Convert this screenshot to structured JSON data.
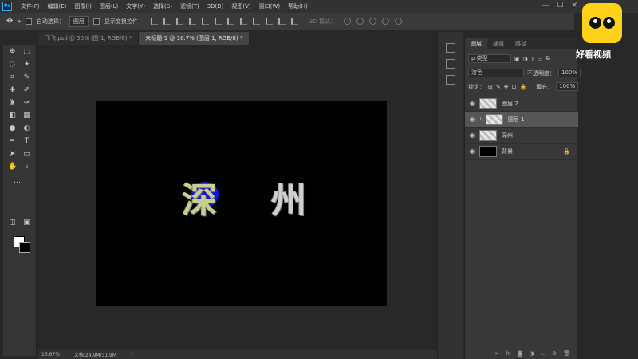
{
  "app": {
    "logo": "Ps"
  },
  "menu": [
    "文件(F)",
    "编辑(E)",
    "图像(I)",
    "图层(L)",
    "文字(Y)",
    "选择(S)",
    "滤镜(T)",
    "3D(D)",
    "视图(V)",
    "窗口(W)",
    "帮助(H)"
  ],
  "options": {
    "auto_select": "自动选择：",
    "target": "图层",
    "show_transform": "显示变换控件",
    "mode_3d": "3D 模式："
  },
  "tabs": [
    {
      "label": "飞飞.psd @ 50% (图 1, RGB/8) *",
      "active": false
    },
    {
      "label": "未标题-1 @ 16.7% (图层 1, RGB/8) *",
      "active": true
    }
  ],
  "canvas": {
    "char1": "深",
    "char2": "州"
  },
  "status": {
    "zoom": "16.67%",
    "doc": "文档:24.9M/31.9M"
  },
  "layers_panel": {
    "tabs": [
      "图层",
      "通道",
      "路径"
    ],
    "kind_filter": "ρ 类型",
    "blend_mode": "溶色",
    "opacity_label": "不透明度：",
    "opacity": "100%",
    "lock_label": "锁定：",
    "fill_label": "填充：",
    "fill": "100%",
    "layers": [
      {
        "name": "图层 2",
        "selected": false
      },
      {
        "name": "图层 1",
        "selected": true
      },
      {
        "name": "深州",
        "selected": false
      },
      {
        "name": "背景",
        "selected": false
      }
    ]
  },
  "watermark": {
    "text": "好看视频"
  },
  "colors": {
    "foreground": "#ffffff",
    "background": "#000000",
    "accent_blue": "#1414dc",
    "panel": "#383838"
  }
}
